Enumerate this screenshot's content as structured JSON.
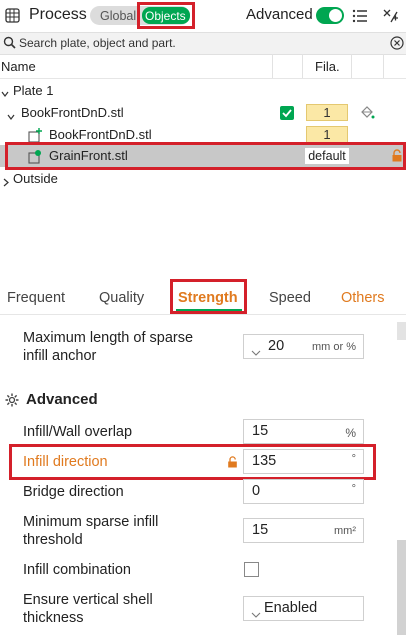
{
  "header": {
    "title": "Process",
    "mode_global": "Global",
    "mode_objects": "Objects",
    "advanced_label": "Advanced",
    "advanced_on": true,
    "accent_color": "#00a651"
  },
  "search": {
    "placeholder": "Search plate, object and part."
  },
  "tree": {
    "col_name": "Name",
    "col_fila": "Fila.",
    "rows": [
      {
        "label": "Plate 1"
      },
      {
        "label": "BookFrontDnD.stl",
        "fila": "1"
      },
      {
        "label": "BookFrontDnD.stl",
        "fila": "1"
      },
      {
        "label": "GrainFront.stl",
        "fila": "default"
      },
      {
        "label": "Outside"
      }
    ]
  },
  "tabs": {
    "items": [
      "Frequent",
      "Quality",
      "Strength",
      "Speed",
      "Others"
    ],
    "active": "Strength"
  },
  "settings": {
    "sparse_anchor": {
      "label_line1": "Maximum length of sparse",
      "label_line2": "infill anchor",
      "value": "20",
      "unit": "mm or %"
    },
    "section_title": "Advanced",
    "infill_wall_overlap": {
      "label": "Infill/Wall overlap",
      "value": "15",
      "unit": "%"
    },
    "infill_direction": {
      "label": "Infill direction",
      "value": "135",
      "unit": "°"
    },
    "bridge_direction": {
      "label": "Bridge direction",
      "value": "0",
      "unit": "°"
    },
    "min_sparse": {
      "label_line1": "Minimum sparse infill",
      "label_line2": "threshold",
      "value": "15",
      "unit": "mm²"
    },
    "infill_combination": {
      "label": "Infill combination",
      "checked": false
    },
    "ensure_vertical": {
      "label_line1": "Ensure vertical shell",
      "label_line2": "thickness",
      "value": "Enabled"
    }
  }
}
